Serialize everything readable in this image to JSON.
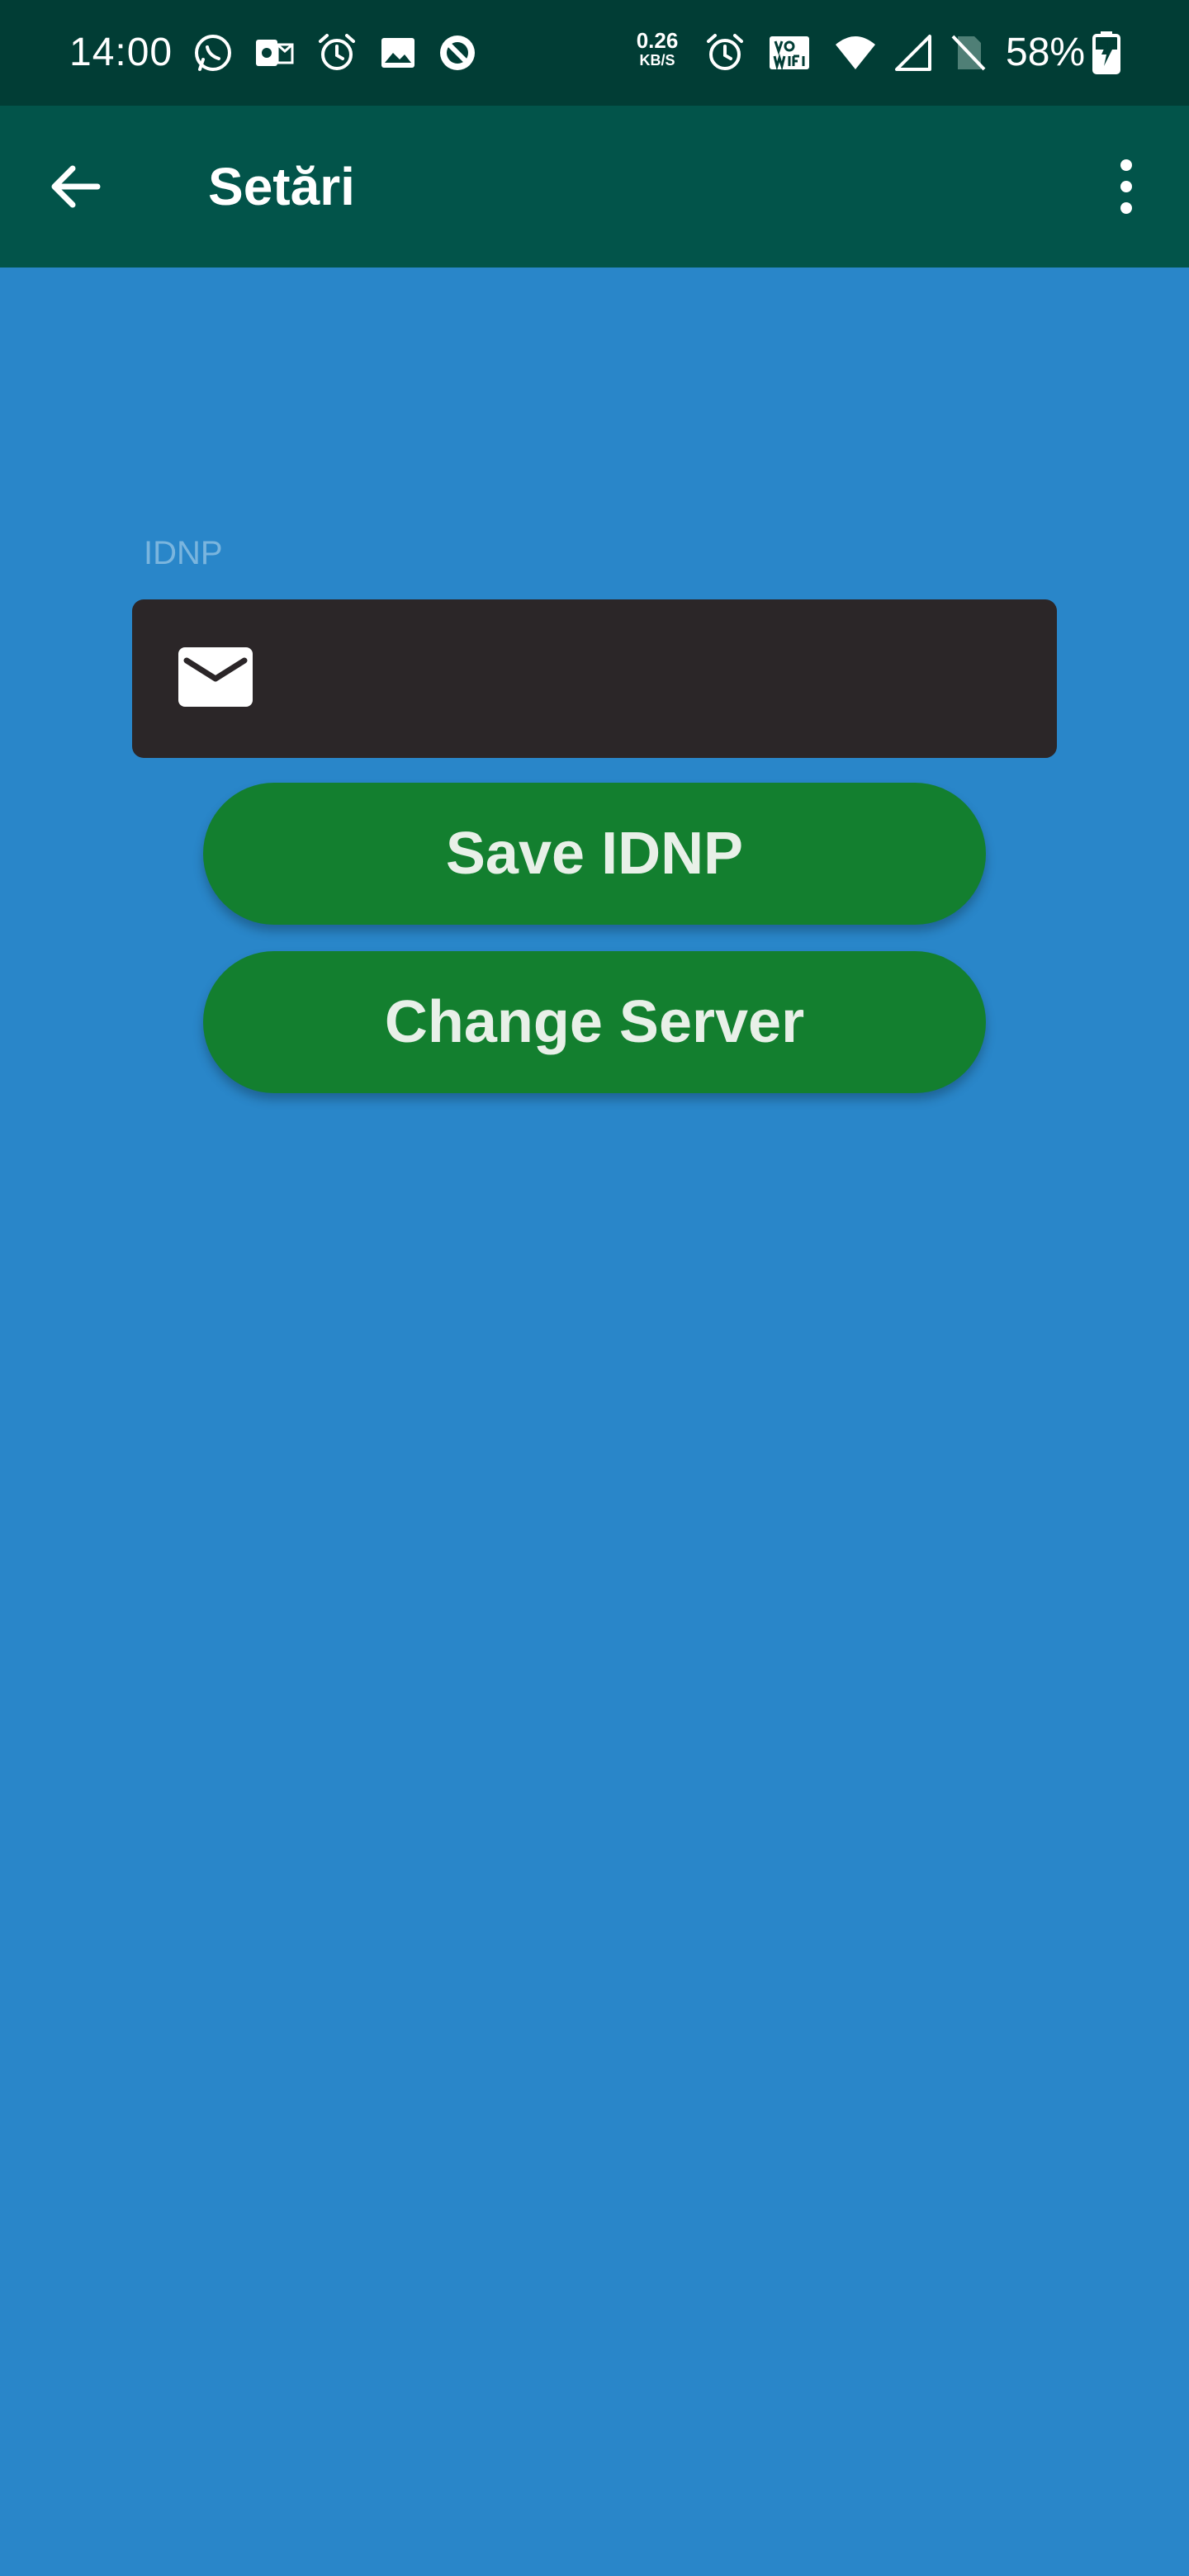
{
  "status_bar": {
    "time": "14:00",
    "net_speed_value": "0.26",
    "net_speed_unit": "KB/S",
    "battery": "58%",
    "icons": [
      "whatsapp-icon",
      "outlook-icon",
      "alarm-icon",
      "gallery-icon",
      "app-icon",
      "alarm-icon",
      "vowifi-icon",
      "wifi-icon",
      "signal-icon",
      "no-sim-icon",
      "battery-charging-icon"
    ]
  },
  "app_bar": {
    "title": "Setări",
    "back_icon": "arrow-left-icon",
    "menu_icon": "more-vert-icon"
  },
  "form": {
    "idnp_label": "IDNP",
    "idnp_value": "",
    "field_icon": "email-icon"
  },
  "buttons": {
    "save": "Save IDNP",
    "change_server": "Change Server"
  },
  "colors": {
    "status_bar": "#013d35",
    "app_bar": "#02544a",
    "background": "#2986c9",
    "input_bg": "#2b2628",
    "button": "#137f2f"
  }
}
